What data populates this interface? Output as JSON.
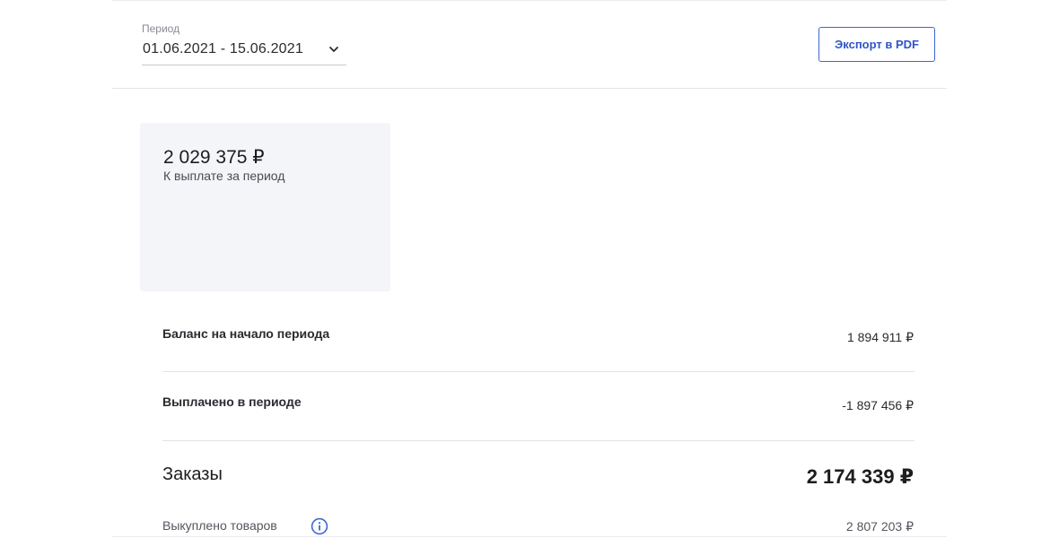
{
  "period": {
    "label": "Период",
    "value": "01.06.2021 - 15.06.2021"
  },
  "toolbar": {
    "export_label": "Экспорт в PDF"
  },
  "summary": {
    "amount": "2 029 375 ₽",
    "caption": "К выплате за период"
  },
  "balance_rows": [
    {
      "label": "Баланс на начало периода",
      "value": "1 894 911 ₽"
    },
    {
      "label": "Выплачено в периоде",
      "value": "-1 897 456 ₽"
    }
  ],
  "orders": {
    "label": "Заказы",
    "value": "2 174 339 ₽",
    "items": [
      {
        "label": "Выкуплено товаров",
        "value": "2 807 203 ₽"
      }
    ]
  },
  "colors": {
    "accent": "#3f66d6",
    "card_background": "#f4f5f9"
  },
  "icons": {
    "period_toggle": "chevron-down-icon",
    "info": "info-icon"
  }
}
